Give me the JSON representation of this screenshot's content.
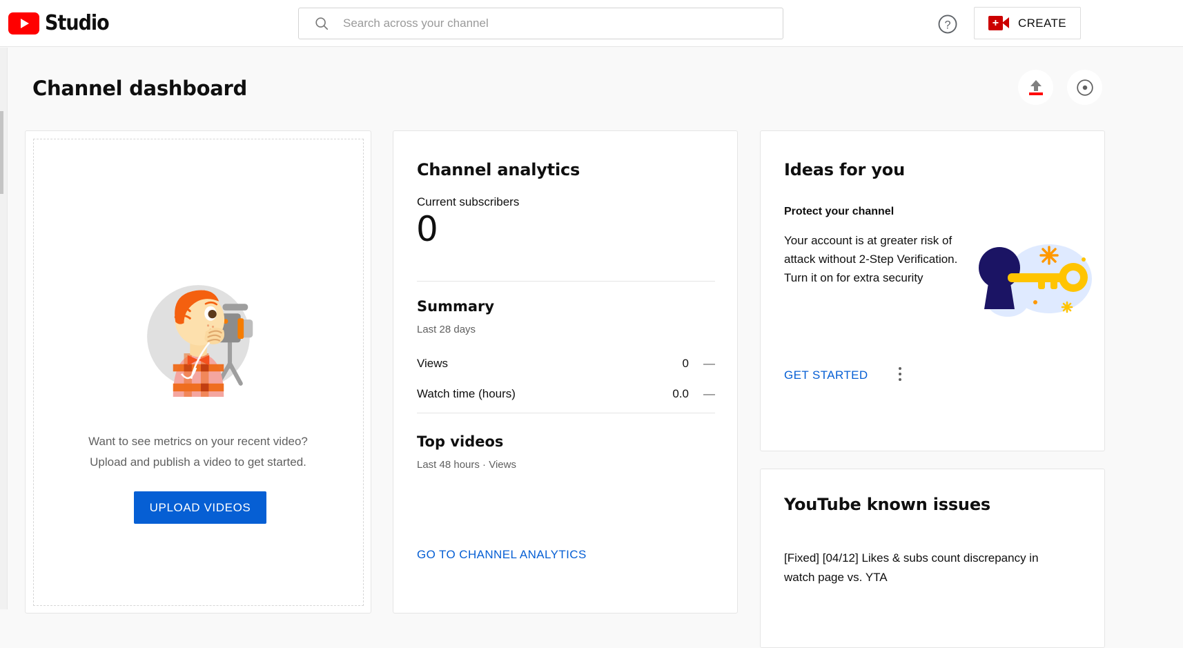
{
  "header": {
    "logo_text": "Studio",
    "search_placeholder": "Search across your channel",
    "search_value": "",
    "help_label": "?",
    "create_label": "CREATE"
  },
  "page": {
    "title": "Channel dashboard"
  },
  "upload_card": {
    "line1": "Want to see metrics on your recent video?",
    "line2": "Upload and publish a video to get started.",
    "button_label": "UPLOAD VIDEOS"
  },
  "analytics_card": {
    "title": "Channel analytics",
    "subscribers_label": "Current subscribers",
    "subscribers_value": "0",
    "summary_title": "Summary",
    "summary_period": "Last 28 days",
    "metrics": [
      {
        "label": "Views",
        "value": "0",
        "trend": "—"
      },
      {
        "label": "Watch time (hours)",
        "value": "0.0",
        "trend": "—"
      }
    ],
    "top_videos_title": "Top videos",
    "top_videos_period": "Last 48 hours · Views",
    "link_label": "GO TO CHANNEL ANALYTICS"
  },
  "ideas_card": {
    "title": "Ideas for you",
    "item_title": "Protect your channel",
    "item_body": "Your account is at greater risk of attack without 2-Step Verification. Turn it on for extra security",
    "cta_label": "GET STARTED"
  },
  "issues_card": {
    "title": "YouTube known issues",
    "item": "[Fixed] [04/12] Likes & subs count discrepancy in watch page vs. YTA"
  },
  "colors": {
    "brand_red": "#ff0000",
    "link_blue": "#065fd4",
    "button_blue": "#065fd4",
    "text_primary": "#0f0f0f",
    "text_secondary": "#606060",
    "page_bg": "#f9f9f9"
  }
}
